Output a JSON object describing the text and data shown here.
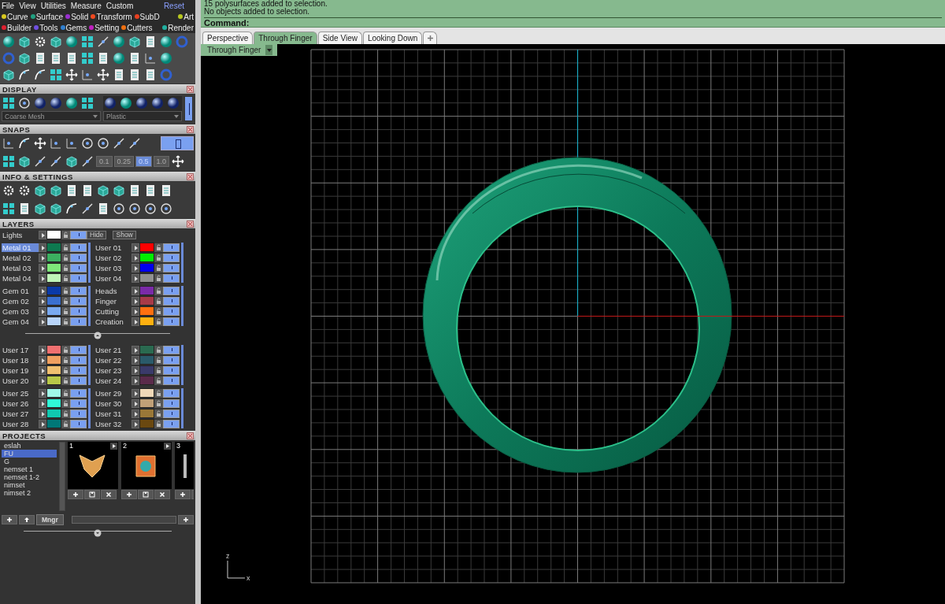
{
  "menu": {
    "items": [
      "File",
      "View",
      "Utilities",
      "Measure",
      "Custom"
    ],
    "reset": "Reset"
  },
  "category_rows": [
    {
      "items": [
        {
          "label": "Curve",
          "color": "#d8c820"
        },
        {
          "label": "Surface",
          "color": "#20a080"
        },
        {
          "label": "Solid",
          "color": "#9a30d0"
        },
        {
          "label": "Transform",
          "color": "#f04a20"
        },
        {
          "label": "SubD",
          "color": "#e84020"
        },
        {
          "label": "Art",
          "color": "#b8c820"
        }
      ]
    },
    {
      "items": [
        {
          "label": "Builder",
          "color": "#e02030"
        },
        {
          "label": "Tools",
          "color": "#7050e0"
        },
        {
          "label": "Gems",
          "color": "#3080d0"
        },
        {
          "label": "Setting",
          "color": "#c020c0"
        },
        {
          "label": "Cutters",
          "color": "#f07010"
        },
        {
          "label": "Render",
          "color": "#20b0a0"
        }
      ]
    }
  ],
  "display": {
    "title": "DISPLAY",
    "mesh": "Coarse Mesh",
    "material": "Plastic"
  },
  "snaps": {
    "title": "SNAPS",
    "steps": [
      {
        "label": "0.1",
        "selected": false
      },
      {
        "label": "0.25",
        "selected": false
      },
      {
        "label": "0.5",
        "selected": true
      },
      {
        "label": "1.0",
        "selected": false
      }
    ]
  },
  "info": {
    "title": "INFO & SETTINGS"
  },
  "layers": {
    "title": "LAYERS",
    "lights": {
      "name": "Lights",
      "color": "#ffffff",
      "visible": true
    },
    "hide": "Hide",
    "show": "Show",
    "groups": [
      {
        "left": [
          {
            "name": "Metal 01",
            "color": "#0e7a50",
            "selected": true,
            "visible": true
          },
          {
            "name": "Metal 02",
            "color": "#3cb060",
            "selected": false,
            "visible": true
          },
          {
            "name": "Metal 03",
            "color": "#7ee87a",
            "selected": false,
            "visible": true
          },
          {
            "name": "Metal 04",
            "color": "#c0f5b8",
            "selected": false,
            "visible": true
          }
        ],
        "right": [
          {
            "name": "User 01",
            "color": "#ff0000",
            "selected": false,
            "visible": true
          },
          {
            "name": "User 02",
            "color": "#00ee00",
            "selected": false,
            "visible": true
          },
          {
            "name": "User 03",
            "color": "#0000ee",
            "selected": false,
            "visible": true
          },
          {
            "name": "User 04",
            "color": "#909090",
            "selected": false,
            "visible": true
          }
        ]
      },
      {
        "left": [
          {
            "name": "Gem 01",
            "color": "#0a3aa8",
            "selected": false,
            "visible": true
          },
          {
            "name": "Gem 02",
            "color": "#3a70d0",
            "selected": false,
            "visible": true
          },
          {
            "name": "Gem 03",
            "color": "#7aaaf0",
            "selected": false,
            "visible": true
          },
          {
            "name": "Gem 04",
            "color": "#b8d4fa",
            "selected": false,
            "visible": true
          }
        ],
        "right": [
          {
            "name": "Heads",
            "color": "#7a2aa8",
            "selected": false,
            "visible": true
          },
          {
            "name": "Finger",
            "color": "#a83a48",
            "selected": false,
            "visible": true
          },
          {
            "name": "Cutting",
            "color": "#ff7010",
            "selected": false,
            "visible": true
          },
          {
            "name": "Creation",
            "color": "#ffb010",
            "selected": false,
            "visible": true
          }
        ]
      },
      {
        "left": [
          {
            "name": "User 17",
            "color": "#f07070",
            "selected": false,
            "visible": true
          },
          {
            "name": "User 18",
            "color": "#f0a060",
            "selected": false,
            "visible": true
          },
          {
            "name": "User 19",
            "color": "#f0c070",
            "selected": false,
            "visible": true
          },
          {
            "name": "User 20",
            "color": "#b8c848",
            "selected": false,
            "visible": true
          }
        ],
        "right": [
          {
            "name": "User 21",
            "color": "#2a6a50",
            "selected": false,
            "visible": true
          },
          {
            "name": "User 22",
            "color": "#2a5a6a",
            "selected": false,
            "visible": true
          },
          {
            "name": "User 23",
            "color": "#3a3a6a",
            "selected": false,
            "visible": true
          },
          {
            "name": "User 24",
            "color": "#5a2a4a",
            "selected": false,
            "visible": true
          }
        ]
      },
      {
        "left": [
          {
            "name": "User 25",
            "color": "#a0f8e8",
            "selected": false,
            "visible": true
          },
          {
            "name": "User 26",
            "color": "#30f8d8",
            "selected": false,
            "visible": true
          },
          {
            "name": "User 27",
            "color": "#10c8b0",
            "selected": false,
            "visible": true
          },
          {
            "name": "User 28",
            "color": "#007878",
            "selected": false,
            "visible": true
          }
        ],
        "right": [
          {
            "name": "User 29",
            "color": "#f0d8b8",
            "selected": false,
            "visible": true
          },
          {
            "name": "User 30",
            "color": "#c0a078",
            "selected": false,
            "visible": true
          },
          {
            "name": "User 31",
            "color": "#9a7838",
            "selected": false,
            "visible": true
          },
          {
            "name": "User 32",
            "color": "#6a4810",
            "selected": false,
            "visible": true
          }
        ]
      }
    ]
  },
  "projects": {
    "title": "PROJECTS",
    "items": [
      {
        "label": "eslah",
        "selected": false
      },
      {
        "label": "FU",
        "selected": true
      },
      {
        "label": "G",
        "selected": false
      },
      {
        "label": "nemset 1",
        "selected": false
      },
      {
        "label": "nemset 1-2",
        "selected": false
      },
      {
        "label": "nimset",
        "selected": false
      },
      {
        "label": "nimset 2",
        "selected": false
      }
    ],
    "thumbnails": [
      {
        "number": "1"
      },
      {
        "number": "2"
      },
      {
        "number": "3"
      }
    ],
    "manager": "Mngr"
  },
  "command": {
    "lines": [
      "15 polysurfaces added to selection.",
      "No objects added to selection."
    ],
    "prompt": "Command:"
  },
  "tabs": [
    {
      "label": "Perspective",
      "selected": false
    },
    {
      "label": "Through Finger",
      "selected": true
    },
    {
      "label": "Side View",
      "selected": false
    },
    {
      "label": "Looking Down",
      "selected": false
    }
  ],
  "viewport": {
    "label": "Through Finger",
    "axes": [
      "z",
      "x"
    ]
  }
}
